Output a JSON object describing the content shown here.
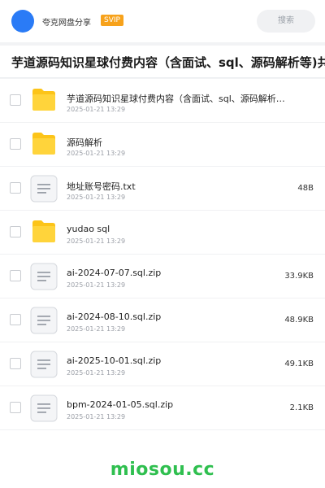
{
  "header": {
    "brand": "夸克网盘分享",
    "badge": "SVIP",
    "search_placeholder": "搜索",
    "colors": {
      "avatar": "#2a7bf6",
      "badge": "#f7a21b"
    }
  },
  "share_title": "芋道源码知识星球付费内容（含面试、sql、源码解析等)共",
  "files": [
    {
      "type": "folder",
      "name": "芋道源码知识星球付费内容（含面试、sql、源码解析…",
      "date": "2025-01-21 13:29",
      "size": ""
    },
    {
      "type": "folder",
      "name": "源码解析",
      "date": "2025-01-21 13:29",
      "size": ""
    },
    {
      "type": "file",
      "name": "地址账号密码.txt",
      "date": "2025-01-21 13:29",
      "size": "48B"
    },
    {
      "type": "folder",
      "name": "yudao sql",
      "date": "2025-01-21 13:29",
      "size": ""
    },
    {
      "type": "file",
      "name": "ai-2024-07-07.sql.zip",
      "date": "2025-01-21 13:29",
      "size": "33.9KB"
    },
    {
      "type": "file",
      "name": "ai-2024-08-10.sql.zip",
      "date": "2025-01-21 13:29",
      "size": "48.9KB"
    },
    {
      "type": "file",
      "name": "ai-2025-10-01.sql.zip",
      "date": "2025-01-21 13:29",
      "size": "49.1KB"
    },
    {
      "type": "file",
      "name": "bpm-2024-01-05.sql.zip",
      "date": "2025-01-21 13:29",
      "size": "2.1KB"
    }
  ],
  "icons": {
    "folder": "folder-icon",
    "file": "document-icon"
  },
  "watermark": "miosou.cc"
}
